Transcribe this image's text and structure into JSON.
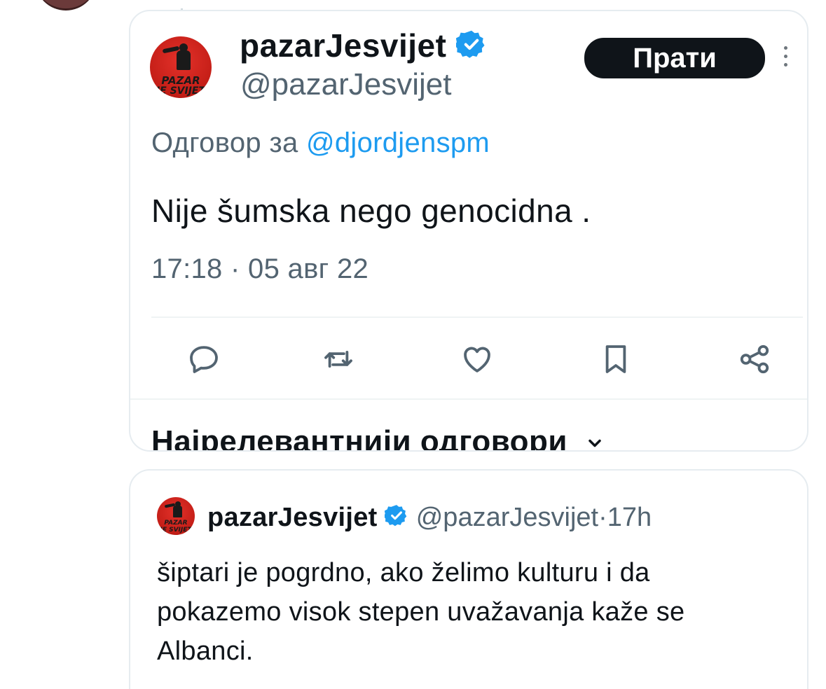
{
  "colors": {
    "accent": "#1d9bf0",
    "text_primary": "#0f1419",
    "text_secondary": "#536471",
    "logo_red": "#d62b22"
  },
  "main_tweet": {
    "display_name": "pazarJesvijet",
    "handle": "@pazarJesvijet",
    "verified_icon": "verified-badge-icon",
    "avatar_logo": {
      "line1": "PAZAR",
      "line2": "JE SVIJET"
    },
    "follow_label": "Прати",
    "more_icon": "more-vertical-icon",
    "replying_prefix": "Одговор за",
    "replying_mention": "@djordjenspm",
    "text": "Nije šumska nego genocidna .",
    "timestamp": "17:18 · 05 авг 22",
    "actions": [
      {
        "name": "reply",
        "icon": "reply-icon"
      },
      {
        "name": "retweet",
        "icon": "retweet-icon"
      },
      {
        "name": "like",
        "icon": "heart-icon"
      },
      {
        "name": "bookmark",
        "icon": "bookmark-icon"
      },
      {
        "name": "share",
        "icon": "share-icon"
      }
    ],
    "replies_sort_label": "Најрелевантнији одговори"
  },
  "quoted_tweet": {
    "display_name": "pazarJesvijet",
    "handle": "@pazarJesvijet",
    "separator": "·",
    "time": "17h",
    "avatar_logo": {
      "line1": "PAZAR",
      "line2": "JE SVIJET"
    },
    "text": "šiptari je pogrdno, ako želimo kulturu i da pokazemo visok stepen uvažavanja kaže se Albanci."
  }
}
